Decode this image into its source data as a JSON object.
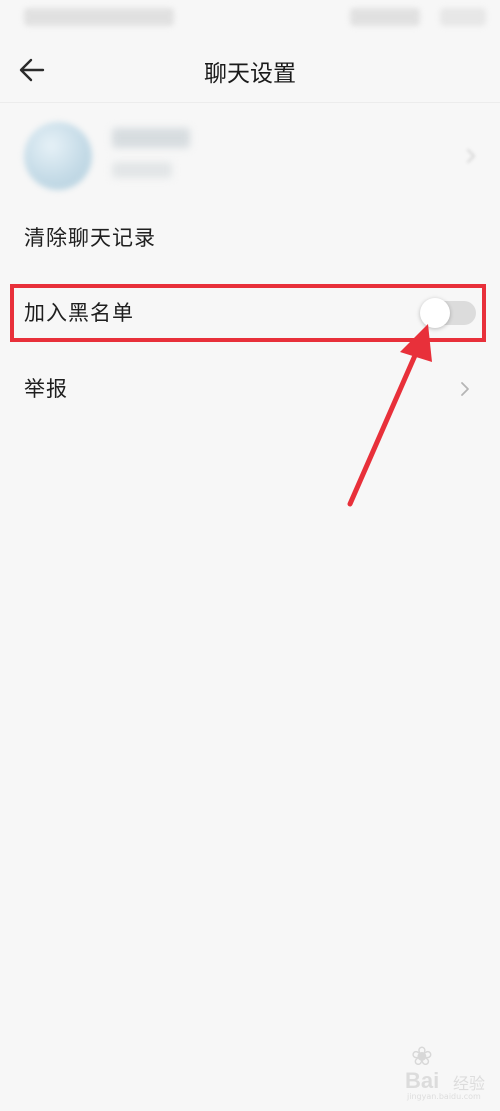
{
  "header": {
    "title": "聊天设置",
    "back_icon": "arrow-left-icon"
  },
  "settings": {
    "items": [
      {
        "label": "清除聊天记录",
        "type": "action"
      },
      {
        "label": "加入黑名单",
        "type": "toggle",
        "enabled": false
      },
      {
        "label": "举报",
        "type": "link",
        "icon": "chevron-right-icon"
      }
    ]
  },
  "colors": {
    "highlight": "#e8303a",
    "toggle_track_off": "#dcdcdc",
    "background": "#f7f7f7"
  },
  "watermark": {
    "brand": "Bai",
    "sub": "经验",
    "url": "jingyan.baidu.com"
  }
}
